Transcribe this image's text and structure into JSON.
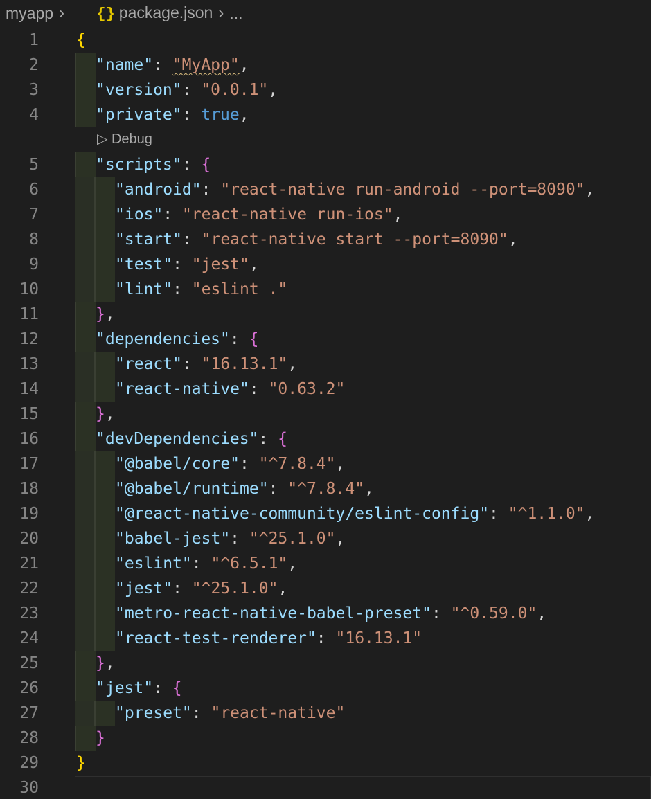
{
  "breadcrumb": {
    "folder": "myapp",
    "file": "package.json",
    "more": "...",
    "json_icon_glyph": "{}"
  },
  "codelens": {
    "debug_label": "Debug",
    "play_glyph": "▷"
  },
  "colors": {
    "background": "#1e1e1e",
    "key": "#9cdcfe",
    "string": "#ce9178",
    "boolean": "#569cd6",
    "punctuation": "#d4d4d4",
    "bracket_level1": "#ffd700",
    "bracket_level2": "#da70d6",
    "line_number": "#858585"
  },
  "lines": [
    {
      "n": "1",
      "t": [
        [
          "br1",
          "{"
        ]
      ]
    },
    {
      "n": "2",
      "t": [
        [
          "k",
          "\"name\""
        ],
        [
          "p",
          ": "
        ],
        [
          "sq",
          "\"MyApp\""
        ],
        [
          "p",
          ","
        ]
      ]
    },
    {
      "n": "3",
      "t": [
        [
          "k",
          "\"version\""
        ],
        [
          "p",
          ": "
        ],
        [
          "s",
          "\"0.0.1\""
        ],
        [
          "p",
          ","
        ]
      ]
    },
    {
      "n": "4",
      "t": [
        [
          "k",
          "\"private\""
        ],
        [
          "p",
          ": "
        ],
        [
          "b",
          "true"
        ],
        [
          "p",
          ","
        ]
      ]
    },
    {
      "n": "5",
      "t": [
        [
          "k",
          "\"scripts\""
        ],
        [
          "p",
          ": "
        ],
        [
          "br2",
          "{"
        ]
      ]
    },
    {
      "n": "6",
      "t": [
        [
          "k",
          "\"android\""
        ],
        [
          "p",
          ": "
        ],
        [
          "s",
          "\"react-native run-android --port=8090\""
        ],
        [
          "p",
          ","
        ]
      ]
    },
    {
      "n": "7",
      "t": [
        [
          "k",
          "\"ios\""
        ],
        [
          "p",
          ": "
        ],
        [
          "s",
          "\"react-native run-ios\""
        ],
        [
          "p",
          ","
        ]
      ]
    },
    {
      "n": "8",
      "t": [
        [
          "k",
          "\"start\""
        ],
        [
          "p",
          ": "
        ],
        [
          "s",
          "\"react-native start --port=8090\""
        ],
        [
          "p",
          ","
        ]
      ]
    },
    {
      "n": "9",
      "t": [
        [
          "k",
          "\"test\""
        ],
        [
          "p",
          ": "
        ],
        [
          "s",
          "\"jest\""
        ],
        [
          "p",
          ","
        ]
      ]
    },
    {
      "n": "10",
      "t": [
        [
          "k",
          "\"lint\""
        ],
        [
          "p",
          ": "
        ],
        [
          "s",
          "\"eslint .\""
        ]
      ]
    },
    {
      "n": "11",
      "t": [
        [
          "br2",
          "}"
        ],
        [
          "p",
          ","
        ]
      ]
    },
    {
      "n": "12",
      "t": [
        [
          "k",
          "\"dependencies\""
        ],
        [
          "p",
          ": "
        ],
        [
          "br2",
          "{"
        ]
      ]
    },
    {
      "n": "13",
      "t": [
        [
          "k",
          "\"react\""
        ],
        [
          "p",
          ": "
        ],
        [
          "s",
          "\"16.13.1\""
        ],
        [
          "p",
          ","
        ]
      ]
    },
    {
      "n": "14",
      "t": [
        [
          "k",
          "\"react-native\""
        ],
        [
          "p",
          ": "
        ],
        [
          "s",
          "\"0.63.2\""
        ]
      ]
    },
    {
      "n": "15",
      "t": [
        [
          "br2",
          "}"
        ],
        [
          "p",
          ","
        ]
      ]
    },
    {
      "n": "16",
      "t": [
        [
          "k",
          "\"devDependencies\""
        ],
        [
          "p",
          ": "
        ],
        [
          "br2",
          "{"
        ]
      ]
    },
    {
      "n": "17",
      "t": [
        [
          "k",
          "\"@babel/core\""
        ],
        [
          "p",
          ": "
        ],
        [
          "s",
          "\"^7.8.4\""
        ],
        [
          "p",
          ","
        ]
      ]
    },
    {
      "n": "18",
      "t": [
        [
          "k",
          "\"@babel/runtime\""
        ],
        [
          "p",
          ": "
        ],
        [
          "s",
          "\"^7.8.4\""
        ],
        [
          "p",
          ","
        ]
      ]
    },
    {
      "n": "19",
      "t": [
        [
          "k",
          "\"@react-native-community/eslint-config\""
        ],
        [
          "p",
          ": "
        ],
        [
          "s",
          "\"^1.1.0\""
        ],
        [
          "p",
          ","
        ]
      ]
    },
    {
      "n": "20",
      "t": [
        [
          "k",
          "\"babel-jest\""
        ],
        [
          "p",
          ": "
        ],
        [
          "s",
          "\"^25.1.0\""
        ],
        [
          "p",
          ","
        ]
      ]
    },
    {
      "n": "21",
      "t": [
        [
          "k",
          "\"eslint\""
        ],
        [
          "p",
          ": "
        ],
        [
          "s",
          "\"^6.5.1\""
        ],
        [
          "p",
          ","
        ]
      ]
    },
    {
      "n": "22",
      "t": [
        [
          "k",
          "\"jest\""
        ],
        [
          "p",
          ": "
        ],
        [
          "s",
          "\"^25.1.0\""
        ],
        [
          "p",
          ","
        ]
      ]
    },
    {
      "n": "23",
      "t": [
        [
          "k",
          "\"metro-react-native-babel-preset\""
        ],
        [
          "p",
          ": "
        ],
        [
          "s",
          "\"^0.59.0\""
        ],
        [
          "p",
          ","
        ]
      ]
    },
    {
      "n": "24",
      "t": [
        [
          "k",
          "\"react-test-renderer\""
        ],
        [
          "p",
          ": "
        ],
        [
          "s",
          "\"16.13.1\""
        ]
      ]
    },
    {
      "n": "25",
      "t": [
        [
          "br2",
          "}"
        ],
        [
          "p",
          ","
        ]
      ]
    },
    {
      "n": "26",
      "t": [
        [
          "k",
          "\"jest\""
        ],
        [
          "p",
          ": "
        ],
        [
          "br2",
          "{"
        ]
      ]
    },
    {
      "n": "27",
      "t": [
        [
          "k",
          "\"preset\""
        ],
        [
          "p",
          ": "
        ],
        [
          "s",
          "\"react-native\""
        ]
      ]
    },
    {
      "n": "28",
      "t": [
        [
          "br2",
          "}"
        ]
      ]
    },
    {
      "n": "29",
      "t": [
        [
          "br1",
          "}"
        ]
      ]
    },
    {
      "n": "30",
      "t": []
    }
  ]
}
